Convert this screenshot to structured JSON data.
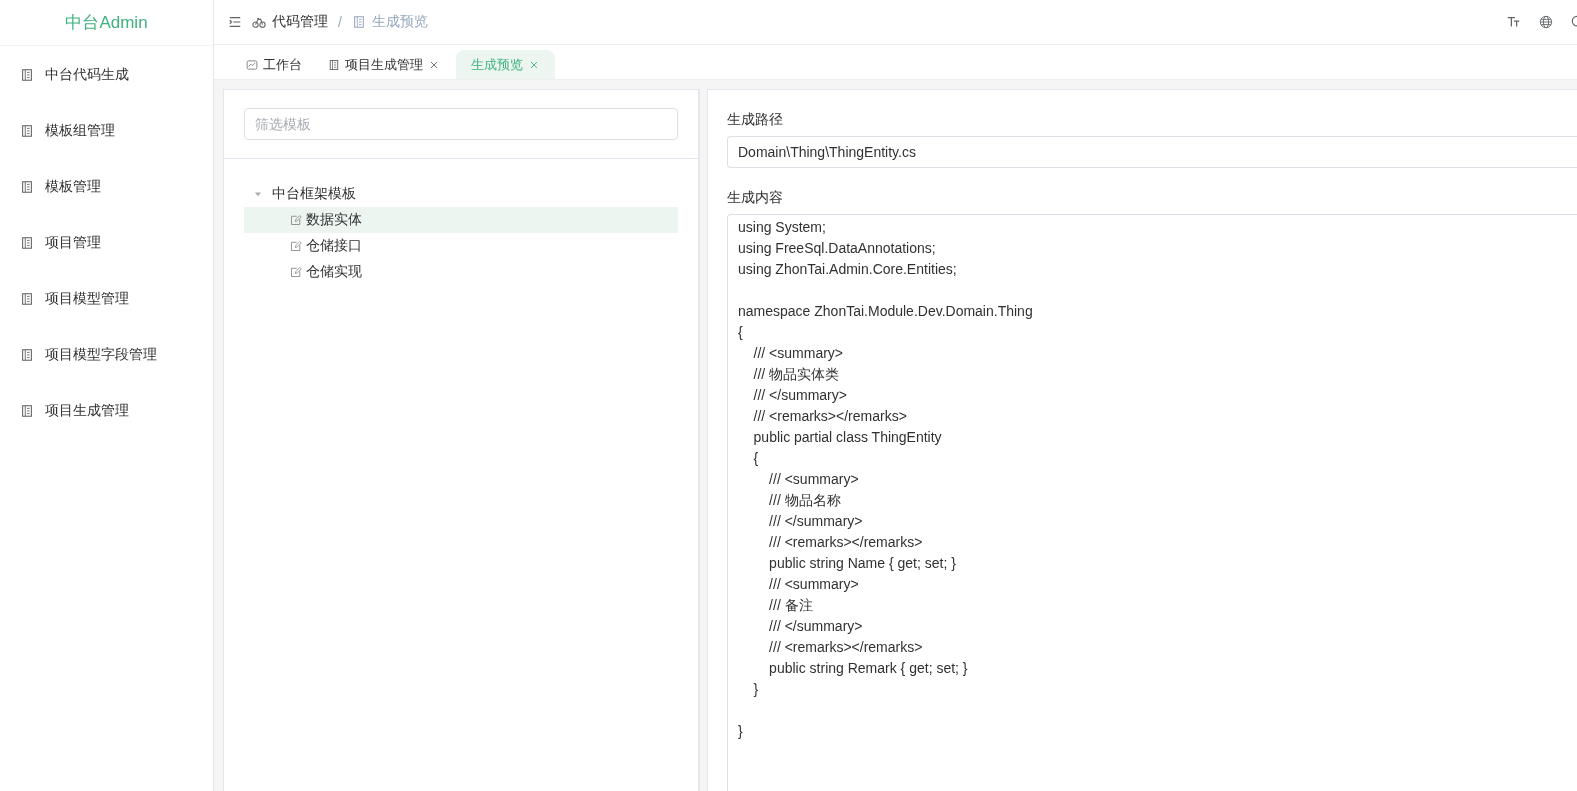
{
  "sidebar": {
    "logo": "中台Admin",
    "items": [
      {
        "label": "中台代码生成",
        "selected": false
      },
      {
        "label": "模板组管理",
        "selected": false
      },
      {
        "label": "模板管理",
        "selected": false
      },
      {
        "label": "项目管理",
        "selected": false
      },
      {
        "label": "项目模型管理",
        "selected": false
      },
      {
        "label": "项目模型字段管理",
        "selected": false
      },
      {
        "label": "项目生成管理",
        "selected": false
      }
    ]
  },
  "breadcrumb": [
    {
      "label": "代码管理",
      "current": false
    },
    {
      "label": "生成预览",
      "current": true
    }
  ],
  "breadcrumb_separator": "/",
  "tabs": [
    {
      "label": "工作台",
      "selected": false,
      "closable": false,
      "kind": "chart"
    },
    {
      "label": "项目生成管理",
      "selected": false,
      "closable": true,
      "kind": "doc"
    },
    {
      "label": "生成预览",
      "selected": true,
      "closable": true,
      "kind": "none"
    }
  ],
  "filter": {
    "placeholder": "筛选模板"
  },
  "tree": [
    {
      "label": "中台框架模板",
      "expanded": true,
      "selected": false,
      "children": [
        {
          "label": "数据实体",
          "selected": true
        },
        {
          "label": "仓储接口",
          "selected": false
        },
        {
          "label": "仓储实现",
          "selected": false
        }
      ]
    }
  ],
  "path_field": {
    "label": "生成路径",
    "value": "Domain\\Thing\\ThingEntity.cs"
  },
  "content_field": {
    "label": "生成内容",
    "blocks": [
      [
        "using System;",
        "using FreeSql.DataAnnotations;",
        "using ZhonTai.Admin.Core.Entities;"
      ],
      [
        "namespace ZhonTai.Module.Dev.Domain.Thing",
        "{",
        "    /// <summary>",
        "    /// 物品实体类",
        "    /// </summary>",
        "    /// <remarks></remarks>",
        "    public partial class ThingEntity",
        "    {",
        "        /// <summary>",
        "        /// 物品名称",
        "        /// </summary>",
        "        /// <remarks></remarks>",
        "        public string Name { get; set; }",
        "        /// <summary>",
        "        /// 备注",
        "        /// </summary>",
        "        /// <remarks></remarks>",
        "        public string Remark { get; set; }",
        "    }"
      ],
      [
        "}"
      ]
    ]
  }
}
